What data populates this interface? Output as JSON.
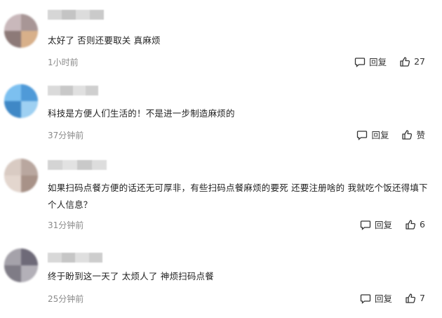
{
  "labels": {
    "reply": "回复"
  },
  "comments": [
    {
      "content": "太好了 否则还要取关 真麻烦",
      "time": "1小时前",
      "likes": "27"
    },
    {
      "content": "科技是方便人们生活的！不是进一步制造麻烦的",
      "time": "37分钟前",
      "likes": "赞"
    },
    {
      "content": "如果扫码点餐方便的话还无可厚非，有些扫码点餐麻烦的要死 还要注册啥的 我就吃个饭还得填下个人信息？",
      "time": "31分钟前",
      "likes": "6"
    },
    {
      "content": "终于盼到这一天了 太烦人了 神烦扫码点餐",
      "time": "25分钟前",
      "likes": "7"
    }
  ]
}
